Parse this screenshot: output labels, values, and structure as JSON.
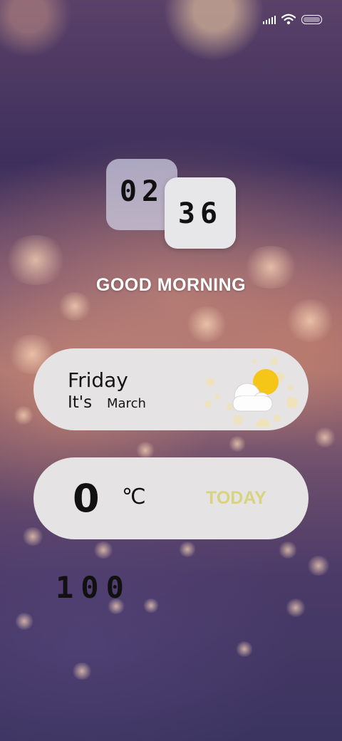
{
  "status_bar": {
    "signal_icon": "signal-bars-icon",
    "wifi_icon": "wifi-icon",
    "battery_icon": "battery-icon"
  },
  "clock": {
    "hour": "02",
    "minute": "36"
  },
  "greeting": "GOOD MORNING",
  "date_widget": {
    "day": "Friday",
    "prefix": "It's",
    "month": "March",
    "weather_icon": "partly-cloudy-sun-icon"
  },
  "temperature_widget": {
    "value": "0",
    "unit": "℃",
    "label": "TODAY"
  },
  "counter": "100",
  "colors": {
    "card_background": "#e5e3e4",
    "today_accent": "#d8d37f",
    "sun": "#f5c518",
    "text_dark": "#111111"
  }
}
